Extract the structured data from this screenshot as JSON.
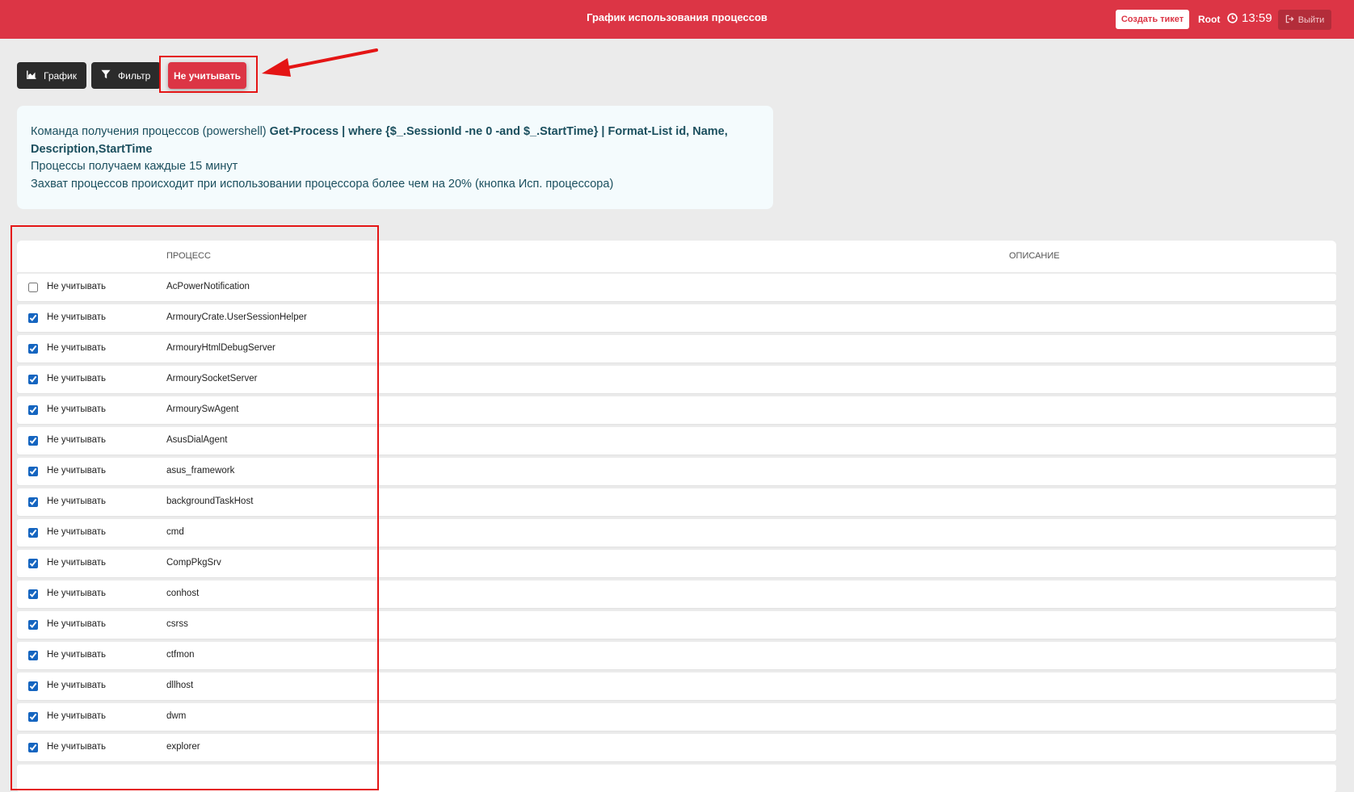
{
  "header": {
    "title": "График использования процессов",
    "create_ticket": "Создать тикет",
    "user": "Root",
    "time": "13:59",
    "logout": "Выйти"
  },
  "toolbar": {
    "chart_label": "График",
    "filter_label": "Фильтр",
    "ignore_label": "Не учитывать"
  },
  "info": {
    "line1_prefix": "Команда получения процессов (powershell) ",
    "line1_command": "Get-Process | where {$_.SessionId -ne 0 -and $_.StartTime} | Format-List id, Name, Description,StartTime",
    "line2": "Процессы получаем каждые 15 минут",
    "line3": "Захват процессов происходит при использовании процессора более чем на 20% (кнопка Исп. процессора)"
  },
  "table": {
    "columns": {
      "process": "ПРОЦЕСС",
      "description": "ОПИСАНИЕ"
    },
    "row_label": "Не учитывать",
    "rows": [
      {
        "process": "AcPowerNotification",
        "checked": false,
        "description": ""
      },
      {
        "process": "ArmouryCrate.UserSessionHelper",
        "checked": true,
        "description": ""
      },
      {
        "process": "ArmouryHtmlDebugServer",
        "checked": true,
        "description": ""
      },
      {
        "process": "ArmourySocketServer",
        "checked": true,
        "description": ""
      },
      {
        "process": "ArmourySwAgent",
        "checked": true,
        "description": ""
      },
      {
        "process": "AsusDialAgent",
        "checked": true,
        "description": ""
      },
      {
        "process": "asus_framework",
        "checked": true,
        "description": ""
      },
      {
        "process": "backgroundTaskHost",
        "checked": true,
        "description": ""
      },
      {
        "process": "cmd",
        "checked": true,
        "description": ""
      },
      {
        "process": "CompPkgSrv",
        "checked": true,
        "description": ""
      },
      {
        "process": "conhost",
        "checked": true,
        "description": ""
      },
      {
        "process": "csrss",
        "checked": true,
        "description": ""
      },
      {
        "process": "ctfmon",
        "checked": true,
        "description": ""
      },
      {
        "process": "dllhost",
        "checked": true,
        "description": ""
      },
      {
        "process": "dwm",
        "checked": true,
        "description": ""
      },
      {
        "process": "explorer",
        "checked": true,
        "description": ""
      },
      {
        "process": "",
        "checked": false,
        "description": ""
      }
    ]
  },
  "colors": {
    "brand_red": "#dc3545",
    "annotation_red": "#e41515",
    "dark_button": "#2b2b2b",
    "info_bg": "#f4fbfd",
    "checkbox_blue": "#1565c0"
  },
  "icons": {
    "chart": "area-chart-icon",
    "filter": "funnel-icon",
    "clock": "clock-icon",
    "logout": "sign-out-icon"
  }
}
